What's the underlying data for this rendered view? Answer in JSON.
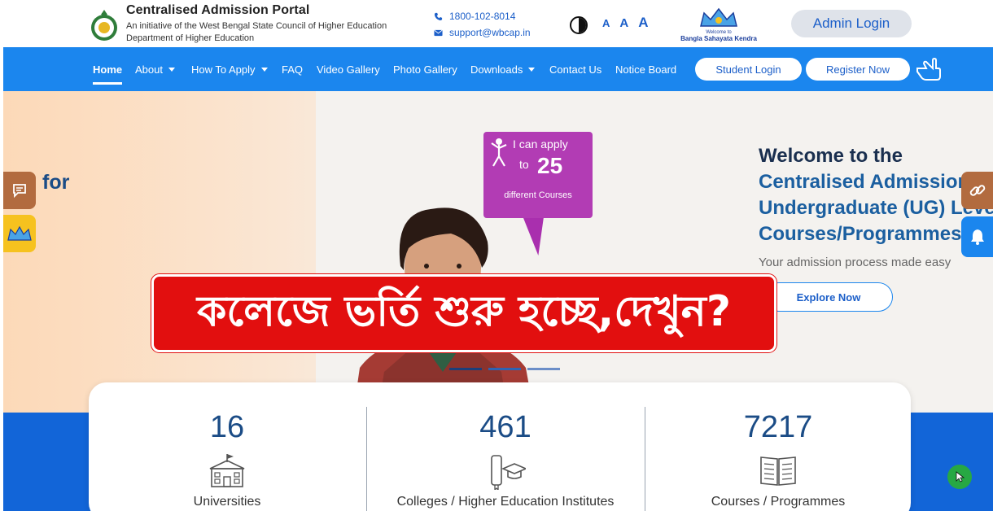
{
  "header": {
    "title": "Centralised Admission Portal",
    "subtitle": "An initiative of the West Bengal State Council of Higher Education",
    "department": "Department of Higher Education",
    "phone": "1800-102-8014",
    "email": "support@wbcap.in",
    "font_small": "A",
    "font_normal": "A",
    "font_large": "A",
    "bsk_line1": "Welcome to",
    "bsk_line2": "Bangla Sahayata Kendra",
    "admin_login": "Admin Login"
  },
  "nav": {
    "items": [
      {
        "label": "Home",
        "active": true
      },
      {
        "label": "About",
        "dropdown": true
      },
      {
        "label": "How To Apply",
        "dropdown": true
      },
      {
        "label": "FAQ"
      },
      {
        "label": "Video Gallery"
      },
      {
        "label": "Photo Gallery"
      },
      {
        "label": "Downloads",
        "dropdown": true
      },
      {
        "label": "Contact Us"
      },
      {
        "label": "Notice Board"
      }
    ],
    "student_login": "Student Login",
    "register_now": "Register Now"
  },
  "hero": {
    "left_text": "for",
    "badge_line1": "I can apply",
    "badge_line2": "to",
    "badge_number": "25",
    "badge_line3": "different Courses",
    "welcome_line1": "Welcome to the",
    "welcome_line2": "Centralised Admission",
    "welcome_line3": "Undergraduate (UG) Level",
    "welcome_line4": "Courses/Programmes",
    "tagline": "Your admission process made easy",
    "explore": "Explore Now",
    "carousel_active_index": 1
  },
  "banner": {
    "text": "কলেজে ভর্তি শুরু হচ্ছে,দেখুন?"
  },
  "stats": [
    {
      "value": "16",
      "label": "Universities",
      "icon": "university-building-icon"
    },
    {
      "value": "461",
      "label": "Colleges / Higher Education Institutes",
      "icon": "diploma-graduation-cap-icon"
    },
    {
      "value": "7217",
      "label": "Courses / Programmes",
      "icon": "open-book-icon"
    }
  ],
  "colors": {
    "nav_blue": "#1b86ee",
    "stats_blue": "#1265d8",
    "banner_red": "#e20f0f",
    "badge_purple": "#b23cb4",
    "heading_blue": "#1b5fa0"
  }
}
